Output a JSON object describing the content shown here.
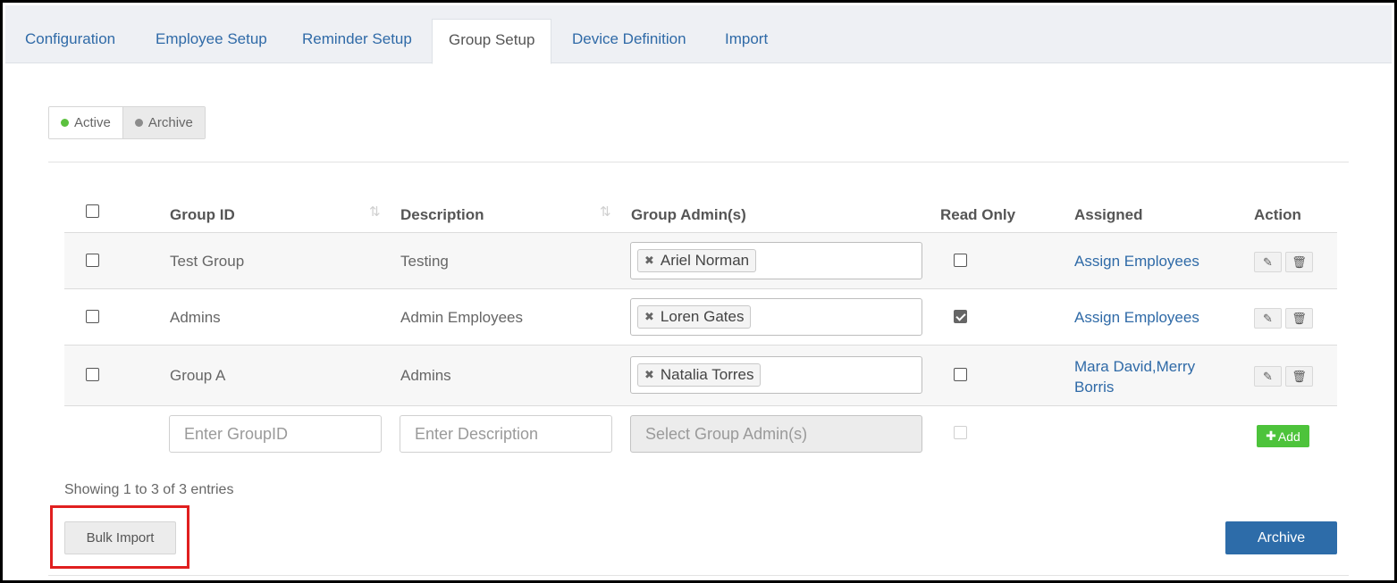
{
  "tabs": [
    {
      "label": "Configuration"
    },
    {
      "label": "Employee Setup"
    },
    {
      "label": "Reminder Setup"
    },
    {
      "label": "Group Setup",
      "active": true
    },
    {
      "label": "Device Definition"
    },
    {
      "label": "Import"
    }
  ],
  "status_toggle": {
    "active_label": "Active",
    "archive_label": "Archive",
    "active_color": "#5cc13f",
    "archive_color": "#8c8c8c"
  },
  "table": {
    "columns": [
      "Group ID",
      "Description",
      "Group Admin(s)",
      "Read Only",
      "Assigned",
      "Action"
    ],
    "rows": [
      {
        "group_id": "Test Group",
        "description": "Testing",
        "admin": "Ariel Norman",
        "read_only": false,
        "assigned": "Assign Employees"
      },
      {
        "group_id": "Admins",
        "description": "Admin Employees",
        "admin": "Loren Gates",
        "read_only": true,
        "assigned": "Assign Employees"
      },
      {
        "group_id": "Group A",
        "description": "Admins",
        "admin": "Natalia Torres",
        "read_only": false,
        "assigned_line1": "Mara David,Merry",
        "assigned_line2": "Borris"
      }
    ],
    "new_row": {
      "group_id_placeholder": "Enter GroupID",
      "description_placeholder": "Enter Description",
      "admin_placeholder": "Select Group Admin(s)",
      "add_label": "Add"
    }
  },
  "footer": {
    "showing": "Showing 1 to 3 of 3 entries",
    "bulk_import_label": "Bulk Import",
    "archive_label": "Archive"
  },
  "colors": {
    "link": "#2f6aa7",
    "add_button": "#4dc33b",
    "archive_button": "#2d6ca9",
    "highlight": "#e01f1f"
  },
  "icons": {
    "edit": "pencil-icon",
    "delete": "trash-icon",
    "sort": "sort-icon",
    "remove": "remove-x-icon",
    "plus": "plus-icon"
  }
}
